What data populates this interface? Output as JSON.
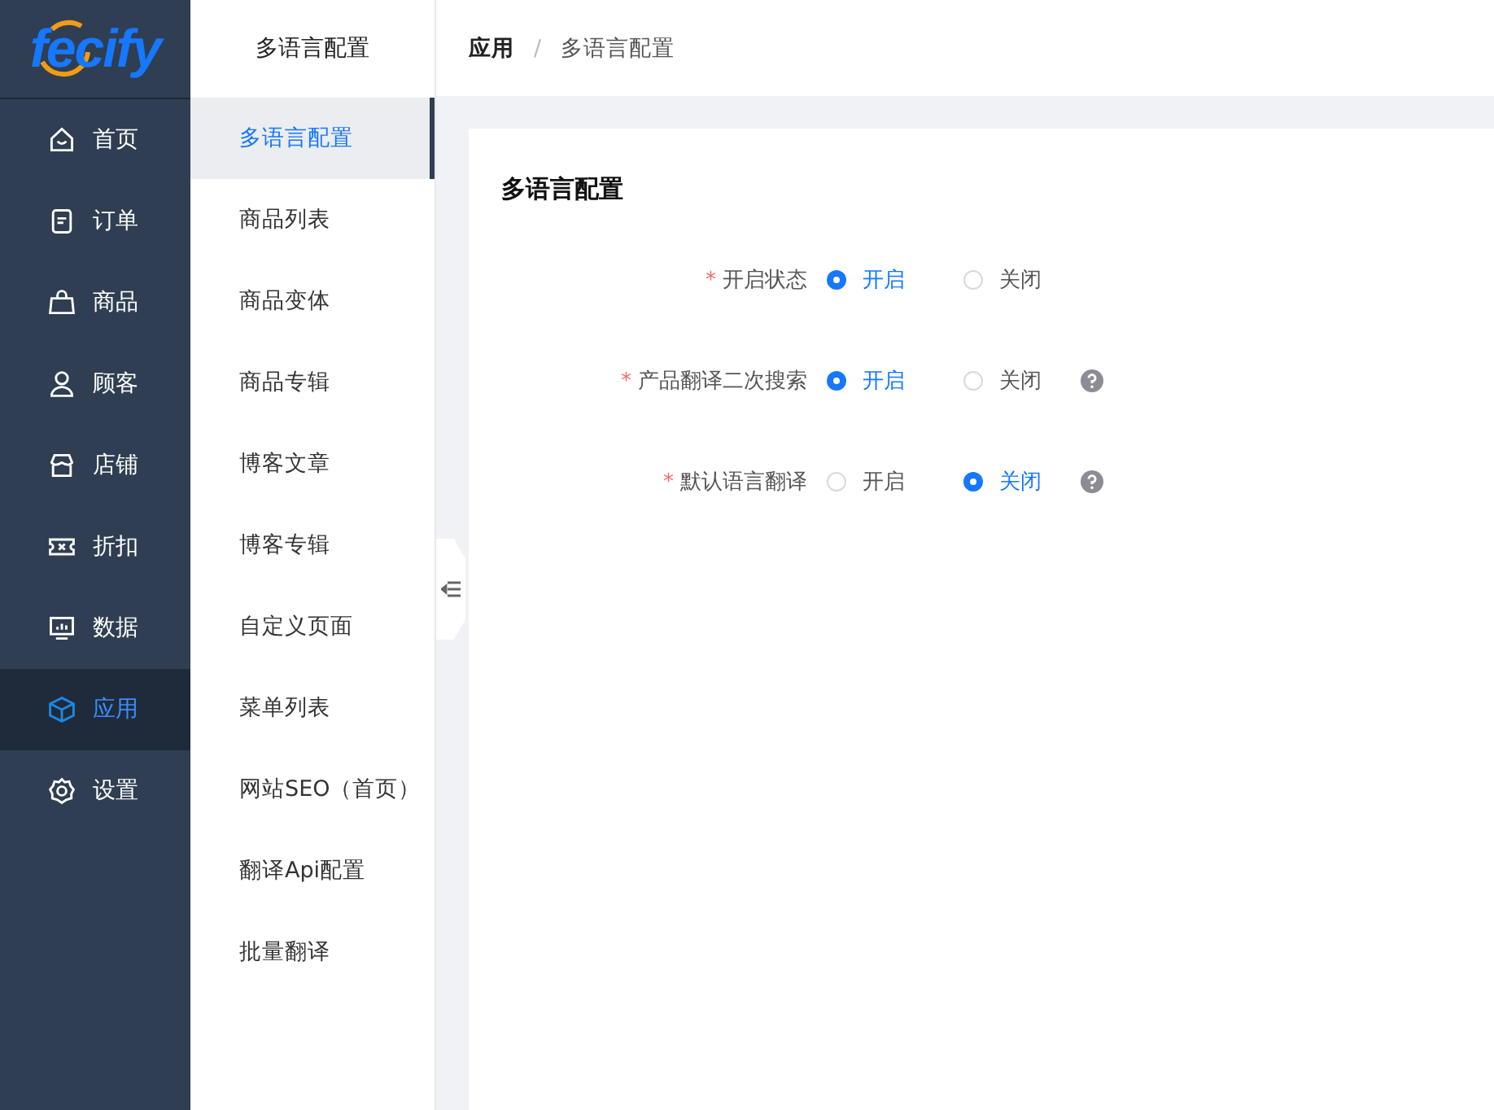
{
  "logo": "fecify",
  "nav": [
    {
      "label": "首页",
      "selected": false
    },
    {
      "label": "订单",
      "selected": false
    },
    {
      "label": "商品",
      "selected": false
    },
    {
      "label": "顾客",
      "selected": false
    },
    {
      "label": "店铺",
      "selected": false
    },
    {
      "label": "折扣",
      "selected": false
    },
    {
      "label": "数据",
      "selected": false
    },
    {
      "label": "应用",
      "selected": true
    },
    {
      "label": "设置",
      "selected": false
    }
  ],
  "submenu": {
    "title": "多语言配置",
    "items": [
      {
        "label": "多语言配置",
        "selected": true
      },
      {
        "label": "商品列表",
        "selected": false
      },
      {
        "label": "商品变体",
        "selected": false
      },
      {
        "label": "商品专辑",
        "selected": false
      },
      {
        "label": "博客文章",
        "selected": false
      },
      {
        "label": "博客专辑",
        "selected": false
      },
      {
        "label": "自定义页面",
        "selected": false
      },
      {
        "label": "菜单列表",
        "selected": false
      },
      {
        "label": "网站SEO（首页）",
        "selected": false
      },
      {
        "label": "翻译Api配置",
        "selected": false
      },
      {
        "label": "批量翻译",
        "selected": false
      }
    ]
  },
  "breadcrumb": [
    "应用",
    "多语言配置"
  ],
  "breadcrumb_separator": "/",
  "required_mark": "*",
  "card": {
    "title": "多语言配置",
    "fields": [
      {
        "label": "开启状态",
        "required": true,
        "help": false,
        "options": [
          {
            "label": "开启",
            "selected": true
          },
          {
            "label": "关闭",
            "selected": false
          }
        ]
      },
      {
        "label": "产品翻译二次搜索",
        "required": true,
        "help": true,
        "options": [
          {
            "label": "开启",
            "selected": true
          },
          {
            "label": "关闭",
            "selected": false
          }
        ]
      },
      {
        "label": "默认语言翻译",
        "required": true,
        "help": true,
        "options": [
          {
            "label": "开启",
            "selected": false
          },
          {
            "label": "关闭",
            "selected": true
          }
        ]
      }
    ]
  }
}
